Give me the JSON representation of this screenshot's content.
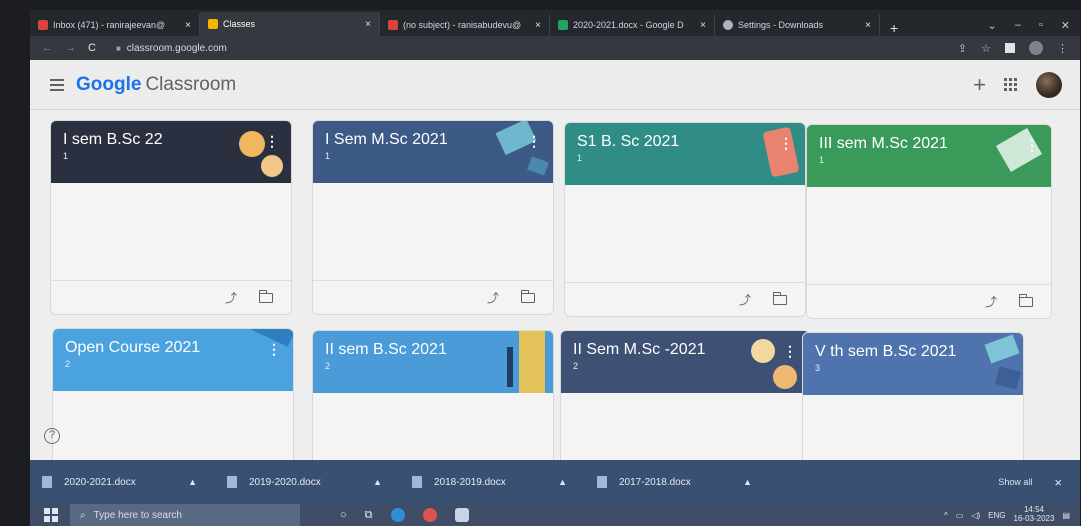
{
  "browser": {
    "tabs": [
      {
        "label": "Inbox (471) - ranirajeevan@",
        "icon": "gmail-icon",
        "active": false
      },
      {
        "label": "Classes",
        "icon": "classroom-icon",
        "active": true
      },
      {
        "label": "(no subject) - ranisabudevu@",
        "icon": "gmail-icon",
        "active": false
      },
      {
        "label": "2020-2021.docx - Google D",
        "icon": "drive-icon",
        "active": false
      },
      {
        "label": "Settings - Downloads",
        "icon": "settings-icon",
        "active": false
      }
    ],
    "close_glyph": "×",
    "new_tab_glyph": "+",
    "url": "classroom.google.com"
  },
  "classroom": {
    "brand_google": "Google",
    "brand_product": "Classroom",
    "plus_glyph": "+",
    "cards": [
      {
        "title": "I sem B.Sc 22",
        "count": "1",
        "color": "#2b3040"
      },
      {
        "title": "I Sem M.Sc 2021",
        "count": "1",
        "color": "#3d5a86"
      },
      {
        "title": "S1 B. Sc 2021",
        "count": "1",
        "color": "#2f8d86"
      },
      {
        "title": "III sem M.Sc 2021",
        "count": "1",
        "color": "#3a9a5a"
      },
      {
        "title": "Open Course 2021",
        "count": "2",
        "color": "#4aa3df"
      },
      {
        "title": "II sem B.Sc 2021",
        "count": "2",
        "color": "#4a9bd8"
      },
      {
        "title": "II Sem M.Sc -2021",
        "count": "2",
        "color": "#3e5074"
      },
      {
        "title": "V th sem B.Sc 2021",
        "count": "3",
        "color": "#4f74ad"
      }
    ],
    "help_glyph": "?"
  },
  "downloads": {
    "items": [
      {
        "name": "2020-2021.docx"
      },
      {
        "name": "2019-2020.docx"
      },
      {
        "name": "2018-2019.docx"
      },
      {
        "name": "2017-2018.docx"
      }
    ],
    "show_all": "Show all",
    "close_glyph": "×"
  },
  "taskbar": {
    "search_placeholder": "Type here to search",
    "language": "ENG",
    "time": "14:54",
    "date": "16-03-2023"
  }
}
